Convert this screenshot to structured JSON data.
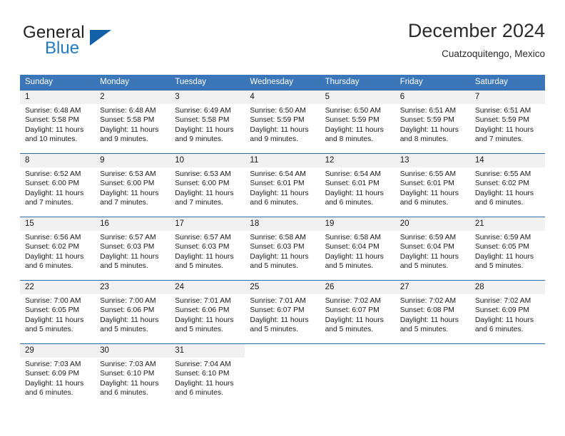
{
  "brand": {
    "word_one": "General",
    "word_two": "Blue",
    "logo_icon": "triangle-icon"
  },
  "header": {
    "title": "December 2024",
    "location": "Cuatzoquitengo, Mexico"
  },
  "colors": {
    "header_blue": "#3b77b8",
    "row_border_blue": "#2e6ba8",
    "day_band_gray": "#f1f1f1",
    "brand_blue": "#1f7bc1",
    "brand_triangle": "#1260a8",
    "text": "#1a1a1a"
  },
  "weekdays": [
    "Sunday",
    "Monday",
    "Tuesday",
    "Wednesday",
    "Thursday",
    "Friday",
    "Saturday"
  ],
  "weeks": [
    [
      {
        "day": "1",
        "sunrise": "Sunrise: 6:48 AM",
        "sunset": "Sunset: 5:58 PM",
        "daylight_line1": "Daylight: 11 hours",
        "daylight_line2": "and 10 minutes."
      },
      {
        "day": "2",
        "sunrise": "Sunrise: 6:48 AM",
        "sunset": "Sunset: 5:58 PM",
        "daylight_line1": "Daylight: 11 hours",
        "daylight_line2": "and 9 minutes."
      },
      {
        "day": "3",
        "sunrise": "Sunrise: 6:49 AM",
        "sunset": "Sunset: 5:58 PM",
        "daylight_line1": "Daylight: 11 hours",
        "daylight_line2": "and 9 minutes."
      },
      {
        "day": "4",
        "sunrise": "Sunrise: 6:50 AM",
        "sunset": "Sunset: 5:59 PM",
        "daylight_line1": "Daylight: 11 hours",
        "daylight_line2": "and 9 minutes."
      },
      {
        "day": "5",
        "sunrise": "Sunrise: 6:50 AM",
        "sunset": "Sunset: 5:59 PM",
        "daylight_line1": "Daylight: 11 hours",
        "daylight_line2": "and 8 minutes."
      },
      {
        "day": "6",
        "sunrise": "Sunrise: 6:51 AM",
        "sunset": "Sunset: 5:59 PM",
        "daylight_line1": "Daylight: 11 hours",
        "daylight_line2": "and 8 minutes."
      },
      {
        "day": "7",
        "sunrise": "Sunrise: 6:51 AM",
        "sunset": "Sunset: 5:59 PM",
        "daylight_line1": "Daylight: 11 hours",
        "daylight_line2": "and 7 minutes."
      }
    ],
    [
      {
        "day": "8",
        "sunrise": "Sunrise: 6:52 AM",
        "sunset": "Sunset: 6:00 PM",
        "daylight_line1": "Daylight: 11 hours",
        "daylight_line2": "and 7 minutes."
      },
      {
        "day": "9",
        "sunrise": "Sunrise: 6:53 AM",
        "sunset": "Sunset: 6:00 PM",
        "daylight_line1": "Daylight: 11 hours",
        "daylight_line2": "and 7 minutes."
      },
      {
        "day": "10",
        "sunrise": "Sunrise: 6:53 AM",
        "sunset": "Sunset: 6:00 PM",
        "daylight_line1": "Daylight: 11 hours",
        "daylight_line2": "and 7 minutes."
      },
      {
        "day": "11",
        "sunrise": "Sunrise: 6:54 AM",
        "sunset": "Sunset: 6:01 PM",
        "daylight_line1": "Daylight: 11 hours",
        "daylight_line2": "and 6 minutes."
      },
      {
        "day": "12",
        "sunrise": "Sunrise: 6:54 AM",
        "sunset": "Sunset: 6:01 PM",
        "daylight_line1": "Daylight: 11 hours",
        "daylight_line2": "and 6 minutes."
      },
      {
        "day": "13",
        "sunrise": "Sunrise: 6:55 AM",
        "sunset": "Sunset: 6:01 PM",
        "daylight_line1": "Daylight: 11 hours",
        "daylight_line2": "and 6 minutes."
      },
      {
        "day": "14",
        "sunrise": "Sunrise: 6:55 AM",
        "sunset": "Sunset: 6:02 PM",
        "daylight_line1": "Daylight: 11 hours",
        "daylight_line2": "and 6 minutes."
      }
    ],
    [
      {
        "day": "15",
        "sunrise": "Sunrise: 6:56 AM",
        "sunset": "Sunset: 6:02 PM",
        "daylight_line1": "Daylight: 11 hours",
        "daylight_line2": "and 6 minutes."
      },
      {
        "day": "16",
        "sunrise": "Sunrise: 6:57 AM",
        "sunset": "Sunset: 6:03 PM",
        "daylight_line1": "Daylight: 11 hours",
        "daylight_line2": "and 5 minutes."
      },
      {
        "day": "17",
        "sunrise": "Sunrise: 6:57 AM",
        "sunset": "Sunset: 6:03 PM",
        "daylight_line1": "Daylight: 11 hours",
        "daylight_line2": "and 5 minutes."
      },
      {
        "day": "18",
        "sunrise": "Sunrise: 6:58 AM",
        "sunset": "Sunset: 6:03 PM",
        "daylight_line1": "Daylight: 11 hours",
        "daylight_line2": "and 5 minutes."
      },
      {
        "day": "19",
        "sunrise": "Sunrise: 6:58 AM",
        "sunset": "Sunset: 6:04 PM",
        "daylight_line1": "Daylight: 11 hours",
        "daylight_line2": "and 5 minutes."
      },
      {
        "day": "20",
        "sunrise": "Sunrise: 6:59 AM",
        "sunset": "Sunset: 6:04 PM",
        "daylight_line1": "Daylight: 11 hours",
        "daylight_line2": "and 5 minutes."
      },
      {
        "day": "21",
        "sunrise": "Sunrise: 6:59 AM",
        "sunset": "Sunset: 6:05 PM",
        "daylight_line1": "Daylight: 11 hours",
        "daylight_line2": "and 5 minutes."
      }
    ],
    [
      {
        "day": "22",
        "sunrise": "Sunrise: 7:00 AM",
        "sunset": "Sunset: 6:05 PM",
        "daylight_line1": "Daylight: 11 hours",
        "daylight_line2": "and 5 minutes."
      },
      {
        "day": "23",
        "sunrise": "Sunrise: 7:00 AM",
        "sunset": "Sunset: 6:06 PM",
        "daylight_line1": "Daylight: 11 hours",
        "daylight_line2": "and 5 minutes."
      },
      {
        "day": "24",
        "sunrise": "Sunrise: 7:01 AM",
        "sunset": "Sunset: 6:06 PM",
        "daylight_line1": "Daylight: 11 hours",
        "daylight_line2": "and 5 minutes."
      },
      {
        "day": "25",
        "sunrise": "Sunrise: 7:01 AM",
        "sunset": "Sunset: 6:07 PM",
        "daylight_line1": "Daylight: 11 hours",
        "daylight_line2": "and 5 minutes."
      },
      {
        "day": "26",
        "sunrise": "Sunrise: 7:02 AM",
        "sunset": "Sunset: 6:07 PM",
        "daylight_line1": "Daylight: 11 hours",
        "daylight_line2": "and 5 minutes."
      },
      {
        "day": "27",
        "sunrise": "Sunrise: 7:02 AM",
        "sunset": "Sunset: 6:08 PM",
        "daylight_line1": "Daylight: 11 hours",
        "daylight_line2": "and 5 minutes."
      },
      {
        "day": "28",
        "sunrise": "Sunrise: 7:02 AM",
        "sunset": "Sunset: 6:09 PM",
        "daylight_line1": "Daylight: 11 hours",
        "daylight_line2": "and 6 minutes."
      }
    ],
    [
      {
        "day": "29",
        "sunrise": "Sunrise: 7:03 AM",
        "sunset": "Sunset: 6:09 PM",
        "daylight_line1": "Daylight: 11 hours",
        "daylight_line2": "and 6 minutes."
      },
      {
        "day": "30",
        "sunrise": "Sunrise: 7:03 AM",
        "sunset": "Sunset: 6:10 PM",
        "daylight_line1": "Daylight: 11 hours",
        "daylight_line2": "and 6 minutes."
      },
      {
        "day": "31",
        "sunrise": "Sunrise: 7:04 AM",
        "sunset": "Sunset: 6:10 PM",
        "daylight_line1": "Daylight: 11 hours",
        "daylight_line2": "and 6 minutes."
      },
      {
        "day": "",
        "sunrise": "",
        "sunset": "",
        "daylight_line1": "",
        "daylight_line2": ""
      },
      {
        "day": "",
        "sunrise": "",
        "sunset": "",
        "daylight_line1": "",
        "daylight_line2": ""
      },
      {
        "day": "",
        "sunrise": "",
        "sunset": "",
        "daylight_line1": "",
        "daylight_line2": ""
      },
      {
        "day": "",
        "sunrise": "",
        "sunset": "",
        "daylight_line1": "",
        "daylight_line2": ""
      }
    ]
  ]
}
